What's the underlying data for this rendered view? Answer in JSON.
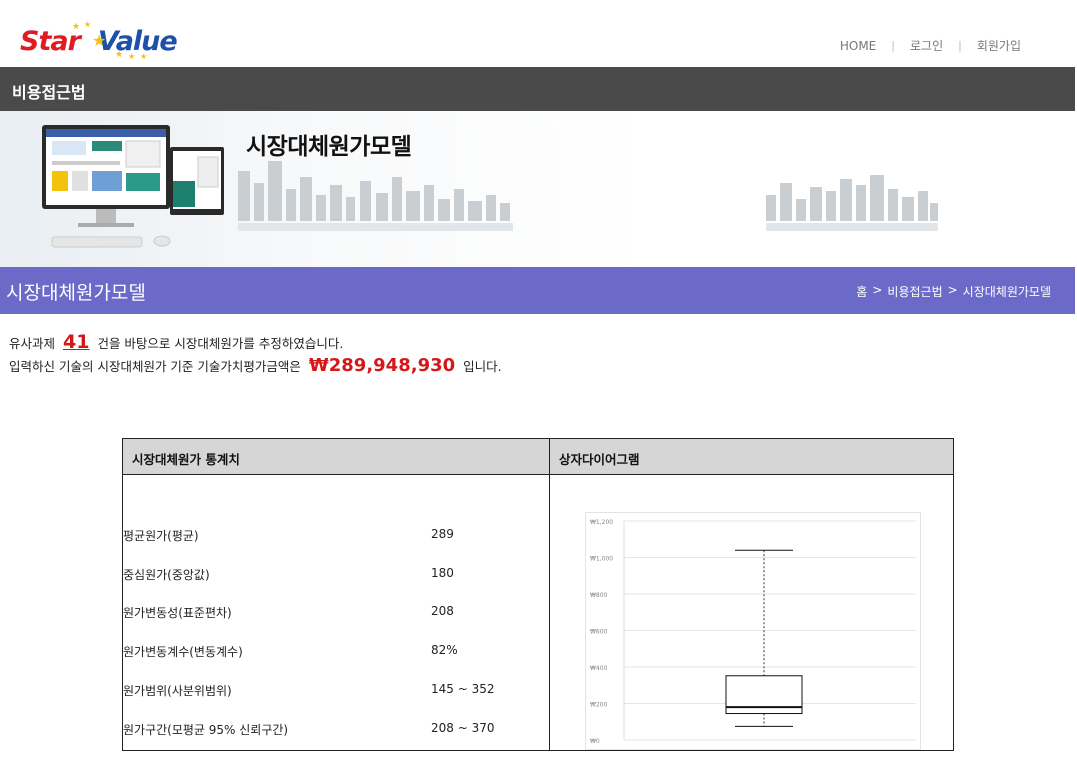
{
  "header": {
    "logo_star": "Star",
    "logo_value": "Value",
    "nav": [
      {
        "label": "HOME"
      },
      {
        "label": "로그인"
      },
      {
        "label": "회원가입"
      }
    ]
  },
  "section_bar": {
    "title": "비용접근법"
  },
  "banner": {
    "title": "시장대체원가모델"
  },
  "page_bar": {
    "title": "시장대체원가모델",
    "breadcrumb": [
      "홈",
      ">",
      "비용접근법",
      ">",
      "시장대체원가모델"
    ]
  },
  "summary": {
    "line1_prefix": "유사과제",
    "count": "41",
    "line1_suffix": "건을 바탕으로 시장대체원가를 추정하였습니다.",
    "line2_prefix": "입력하신 기술의 시장대체원가 기준 기술가치평가금액은",
    "amount": "₩289,948,930",
    "line2_suffix": "입니다."
  },
  "stats_table": {
    "header_left": "시장대체원가 통계치",
    "header_right": "상자다이어그램",
    "rows": [
      {
        "label": "평균원가(평균)",
        "value": "289"
      },
      {
        "label": "중심원가(중앙값)",
        "value": "180"
      },
      {
        "label": "원가변동성(표준편차)",
        "value": "208"
      },
      {
        "label": "원가변동계수(변동계수)",
        "value": "82%"
      },
      {
        "label": "원가범위(사분위범위)",
        "value": "145 ~ 352"
      },
      {
        "label": "원가구간(모평균 95% 신뢰구간)",
        "value": "208 ~ 370"
      }
    ]
  },
  "chart_data": {
    "type": "box",
    "ytick_labels": [
      "₩0",
      "₩200",
      "₩400",
      "₩600",
      "₩800",
      "₩1,000",
      "₩1,200"
    ],
    "ylim": [
      0,
      1200
    ],
    "box": {
      "whisker_low": 75,
      "q1": 145,
      "median": 180,
      "q3": 352,
      "whisker_high": 1040
    },
    "colors": {
      "box": "#111111",
      "whisker": "#333333",
      "grid": "#e6e6e6"
    }
  }
}
